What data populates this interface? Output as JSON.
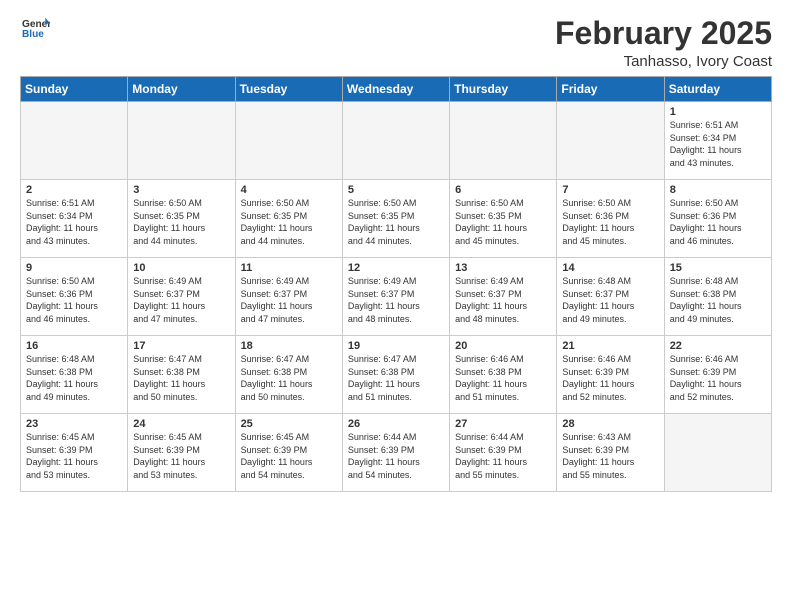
{
  "header": {
    "logo_general": "General",
    "logo_blue": "Blue",
    "month_title": "February 2025",
    "location": "Tanhasso, Ivory Coast"
  },
  "weekdays": [
    "Sunday",
    "Monday",
    "Tuesday",
    "Wednesday",
    "Thursday",
    "Friday",
    "Saturday"
  ],
  "weeks": [
    [
      {
        "day": "",
        "info": ""
      },
      {
        "day": "",
        "info": ""
      },
      {
        "day": "",
        "info": ""
      },
      {
        "day": "",
        "info": ""
      },
      {
        "day": "",
        "info": ""
      },
      {
        "day": "",
        "info": ""
      },
      {
        "day": "1",
        "info": "Sunrise: 6:51 AM\nSunset: 6:34 PM\nDaylight: 11 hours\nand 43 minutes."
      }
    ],
    [
      {
        "day": "2",
        "info": "Sunrise: 6:51 AM\nSunset: 6:34 PM\nDaylight: 11 hours\nand 43 minutes."
      },
      {
        "day": "3",
        "info": "Sunrise: 6:50 AM\nSunset: 6:35 PM\nDaylight: 11 hours\nand 44 minutes."
      },
      {
        "day": "4",
        "info": "Sunrise: 6:50 AM\nSunset: 6:35 PM\nDaylight: 11 hours\nand 44 minutes."
      },
      {
        "day": "5",
        "info": "Sunrise: 6:50 AM\nSunset: 6:35 PM\nDaylight: 11 hours\nand 44 minutes."
      },
      {
        "day": "6",
        "info": "Sunrise: 6:50 AM\nSunset: 6:35 PM\nDaylight: 11 hours\nand 45 minutes."
      },
      {
        "day": "7",
        "info": "Sunrise: 6:50 AM\nSunset: 6:36 PM\nDaylight: 11 hours\nand 45 minutes."
      },
      {
        "day": "8",
        "info": "Sunrise: 6:50 AM\nSunset: 6:36 PM\nDaylight: 11 hours\nand 46 minutes."
      }
    ],
    [
      {
        "day": "9",
        "info": "Sunrise: 6:50 AM\nSunset: 6:36 PM\nDaylight: 11 hours\nand 46 minutes."
      },
      {
        "day": "10",
        "info": "Sunrise: 6:49 AM\nSunset: 6:37 PM\nDaylight: 11 hours\nand 47 minutes."
      },
      {
        "day": "11",
        "info": "Sunrise: 6:49 AM\nSunset: 6:37 PM\nDaylight: 11 hours\nand 47 minutes."
      },
      {
        "day": "12",
        "info": "Sunrise: 6:49 AM\nSunset: 6:37 PM\nDaylight: 11 hours\nand 48 minutes."
      },
      {
        "day": "13",
        "info": "Sunrise: 6:49 AM\nSunset: 6:37 PM\nDaylight: 11 hours\nand 48 minutes."
      },
      {
        "day": "14",
        "info": "Sunrise: 6:48 AM\nSunset: 6:37 PM\nDaylight: 11 hours\nand 49 minutes."
      },
      {
        "day": "15",
        "info": "Sunrise: 6:48 AM\nSunset: 6:38 PM\nDaylight: 11 hours\nand 49 minutes."
      }
    ],
    [
      {
        "day": "16",
        "info": "Sunrise: 6:48 AM\nSunset: 6:38 PM\nDaylight: 11 hours\nand 49 minutes."
      },
      {
        "day": "17",
        "info": "Sunrise: 6:47 AM\nSunset: 6:38 PM\nDaylight: 11 hours\nand 50 minutes."
      },
      {
        "day": "18",
        "info": "Sunrise: 6:47 AM\nSunset: 6:38 PM\nDaylight: 11 hours\nand 50 minutes."
      },
      {
        "day": "19",
        "info": "Sunrise: 6:47 AM\nSunset: 6:38 PM\nDaylight: 11 hours\nand 51 minutes."
      },
      {
        "day": "20",
        "info": "Sunrise: 6:46 AM\nSunset: 6:38 PM\nDaylight: 11 hours\nand 51 minutes."
      },
      {
        "day": "21",
        "info": "Sunrise: 6:46 AM\nSunset: 6:39 PM\nDaylight: 11 hours\nand 52 minutes."
      },
      {
        "day": "22",
        "info": "Sunrise: 6:46 AM\nSunset: 6:39 PM\nDaylight: 11 hours\nand 52 minutes."
      }
    ],
    [
      {
        "day": "23",
        "info": "Sunrise: 6:45 AM\nSunset: 6:39 PM\nDaylight: 11 hours\nand 53 minutes."
      },
      {
        "day": "24",
        "info": "Sunrise: 6:45 AM\nSunset: 6:39 PM\nDaylight: 11 hours\nand 53 minutes."
      },
      {
        "day": "25",
        "info": "Sunrise: 6:45 AM\nSunset: 6:39 PM\nDaylight: 11 hours\nand 54 minutes."
      },
      {
        "day": "26",
        "info": "Sunrise: 6:44 AM\nSunset: 6:39 PM\nDaylight: 11 hours\nand 54 minutes."
      },
      {
        "day": "27",
        "info": "Sunrise: 6:44 AM\nSunset: 6:39 PM\nDaylight: 11 hours\nand 55 minutes."
      },
      {
        "day": "28",
        "info": "Sunrise: 6:43 AM\nSunset: 6:39 PM\nDaylight: 11 hours\nand 55 minutes."
      },
      {
        "day": "",
        "info": ""
      }
    ]
  ]
}
